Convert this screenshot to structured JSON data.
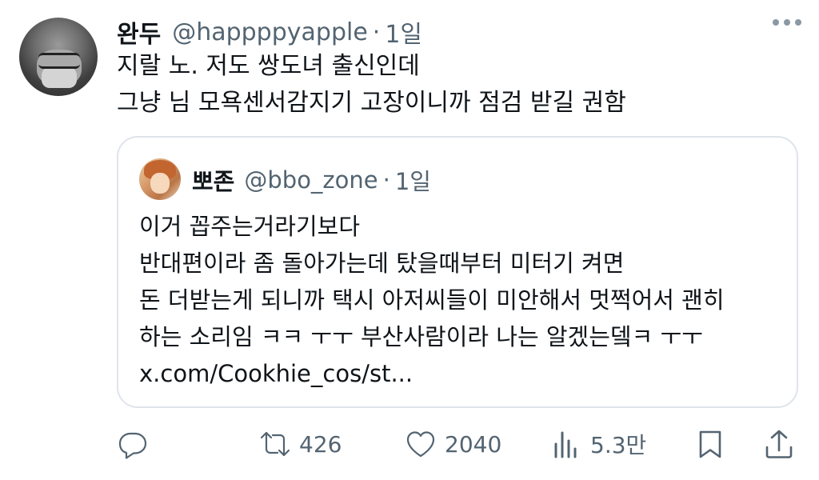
{
  "author": {
    "display_name": "완두",
    "handle": "@happppyapple",
    "separator": "·",
    "time": "1일"
  },
  "tweet": {
    "lines": [
      "지랄 노. 저도 쌍도녀 출신인데",
      "그냥 님 모욕센서감지기 고장이니까 점검 받길 권함"
    ]
  },
  "quote": {
    "display_name": "뽀존",
    "handle": "@bbo_zone",
    "separator": "·",
    "time": "1일",
    "lines": [
      "이거 꼽주는거라기보다",
      "반대편이라 좀 돌아가는데 탔을때부터 미터기 켜면",
      "돈 더받는게 되니까 택시 아저씨들이 미안해서 멋쩍어서 괜히",
      "하는 소리임 ㅋㅋ ㅜㅜ 부산사람이라 나는 알겠는뎈ㅋ ㅜㅜ",
      "x.com/Cookhie_cos/st..."
    ]
  },
  "actions": {
    "reply": {
      "icon": "reply-icon",
      "count": ""
    },
    "retweet": {
      "icon": "retweet-icon",
      "count": "426"
    },
    "like": {
      "icon": "heart-icon",
      "count": "2040"
    },
    "views": {
      "icon": "views-icon",
      "count": "5.3만"
    },
    "bookmark": {
      "icon": "bookmark-icon",
      "count": ""
    },
    "share": {
      "icon": "share-icon",
      "count": ""
    }
  },
  "colors": {
    "text_primary": "#0f1419",
    "text_secondary": "#536471",
    "border": "#dfe4ea"
  }
}
